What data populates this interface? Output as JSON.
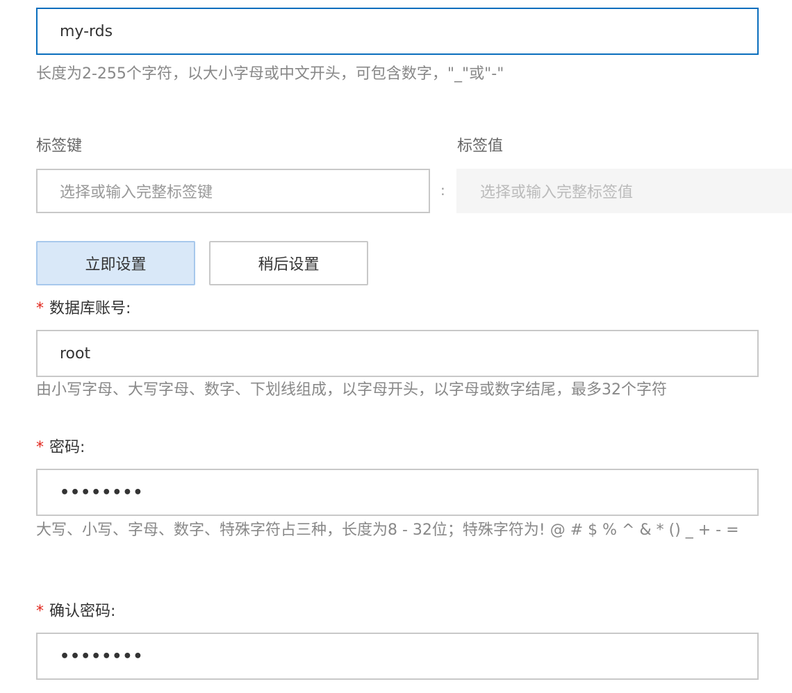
{
  "instance_name": {
    "value": "my-rds",
    "hint": "长度为2-255个字符，以大小字母或中文开头，可包含数字，\"_\"或\"-\""
  },
  "tags": {
    "key_label": "标签键",
    "value_label": "标签值",
    "key_placeholder": "选择或输入完整标签键",
    "separator": ":",
    "value_placeholder": "选择或输入完整标签值"
  },
  "setting_mode": {
    "now_label": "立即设置",
    "later_label": "稍后设置"
  },
  "account": {
    "required_mark": "*",
    "label": "数据库账号:",
    "value": "root",
    "hint": "由小写字母、大写字母、数字、下划线组成，以字母开头，以字母或数字结尾，最多32个字符"
  },
  "password": {
    "required_mark": "*",
    "label": "密码:",
    "masked_value": "••••••••",
    "hint": "大写、小写、字母、数字、特殊字符占三种，长度为8 - 32位；特殊字符为! @ # $ % ^ & * () _ + - ="
  },
  "confirm_password": {
    "required_mark": "*",
    "label": "确认密码:",
    "masked_value": "••••••••"
  }
}
